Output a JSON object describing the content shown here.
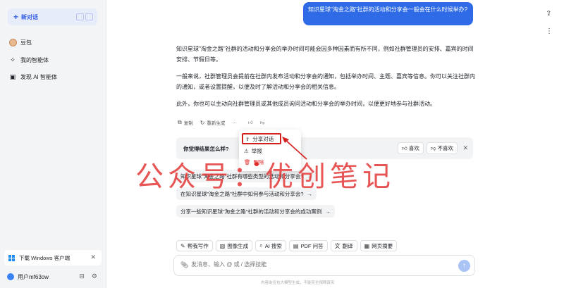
{
  "sidebar": {
    "new_chat": "新对话",
    "items": [
      {
        "label": "豆包",
        "icon": "doubao-avatar-icon"
      },
      {
        "label": "我的智能体",
        "icon": "sparkle-icon"
      },
      {
        "label": "发现 AI 智能体",
        "icon": "grid-icon"
      }
    ],
    "download_label": "下载 Windows 客户端",
    "user_name": "用户mf63ow"
  },
  "chat": {
    "user_question": "知识星球\"淘金之路\"社群的活动和分享会一般会在什么时候举办?",
    "answer": [
      "知识星球\"淘金之路\"社群的活动和分享会的举办时间可能会因多种因素而有所不同，例如社群管理员的安排、嘉宾的时间安排、节假日等。",
      "一般来说，社群管理员会提前在社群内发布活动和分享会的通知，包括举办时间、主题、嘉宾等信息。你可以关注社群内的通知，或者设置提醒，以便及时了解活动和分享会的相关信息。",
      "此外，你也可以主动向社群管理员或其他成员询问活动和分享会的举办时间，以便更好地参与社群活动。"
    ],
    "actions": {
      "copy": "复制",
      "regenerate": "重新生成",
      "more": "···"
    },
    "feedback": {
      "question": "你觉得结果怎么样?",
      "like": "喜欢",
      "dislike": "不喜欢"
    },
    "menu": {
      "share": "分享对话",
      "report": "举报",
      "delete": "删除"
    },
    "suggestions": [
      "知识星球\"淘金之路\"社群有哪些类型的活动和分享会?",
      "在知识星球\"淘金之路\"社群中如何参与活动和分享会?",
      "分享一些知识星球\"淘金之路\"社群的活动和分享会的成功案例"
    ]
  },
  "watermark": "公众号：优创笔记",
  "tools": [
    {
      "label": "帮我写作",
      "icon": "pen-icon"
    },
    {
      "label": "图像生成",
      "icon": "image-icon"
    },
    {
      "label": "AI 搜索",
      "icon": "search-icon"
    },
    {
      "label": "PDF 问答",
      "icon": "pdf-icon"
    },
    {
      "label": "翻译",
      "icon": "translate-icon"
    },
    {
      "label": "网页摘要",
      "icon": "web-summary-icon"
    }
  ],
  "input": {
    "placeholder": "发消息、输入 @ 或 / 选择技能"
  },
  "disclaimer": "内容由豆包大模型生成，不能完全保障真实",
  "colors": {
    "accent": "#2f6be6",
    "danger": "#e22b2b",
    "watermark": "#e23030"
  }
}
